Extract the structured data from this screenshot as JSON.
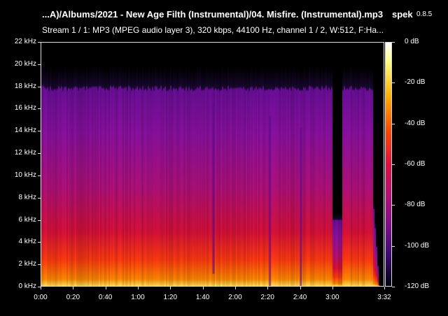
{
  "header": {
    "file_title": "...A)/Albums/2021 - New Age Filth (Instrumental)/04. Misfire. (Instrumental).mp3",
    "app_name": "spek",
    "app_version": "0.8.5",
    "stream_info": "Stream 1 / 1: MP3 (MPEG audio layer 3), 320 kbps, 44100 Hz, channel 1 / 2, W:512, F:Ha..."
  },
  "chart_data": {
    "type": "heatmap",
    "title": "",
    "xlabel": "",
    "ylabel": "",
    "x_ticks": [
      "0:00",
      "0:20",
      "0:40",
      "1:00",
      "1:20",
      "1:40",
      "2:00",
      "2:20",
      "2:40",
      "3:00",
      "3:32"
    ],
    "x_tick_seconds": [
      0,
      20,
      40,
      60,
      80,
      100,
      120,
      140,
      160,
      180,
      212
    ],
    "xlim_seconds": [
      0,
      212
    ],
    "y_ticks": [
      "0 kHz",
      "2 kHz",
      "4 kHz",
      "6 kHz",
      "8 kHz",
      "10 kHz",
      "12 kHz",
      "14 kHz",
      "16 kHz",
      "18 kHz",
      "20 kHz",
      "22 kHz"
    ],
    "y_tick_khz": [
      0,
      2,
      4,
      6,
      8,
      10,
      12,
      14,
      16,
      18,
      20,
      22
    ],
    "ylim_khz": [
      0,
      22
    ],
    "colorbar_ticks": [
      "0 dB",
      "-20 dB",
      "-40 dB",
      "-60 dB",
      "-80 dB",
      "-100 dB",
      "-120 dB"
    ],
    "colorbar_db": [
      0,
      -20,
      -40,
      -60,
      -80,
      -100,
      -120
    ],
    "clim_db": [
      -120,
      0
    ],
    "cutoff_khz": 20,
    "colors": [
      "#000010",
      "#3a0a6e",
      "#7a0e8c",
      "#b0107a",
      "#e01040",
      "#ff4a00",
      "#ffb000",
      "#ffff80",
      "#ffffff"
    ]
  }
}
